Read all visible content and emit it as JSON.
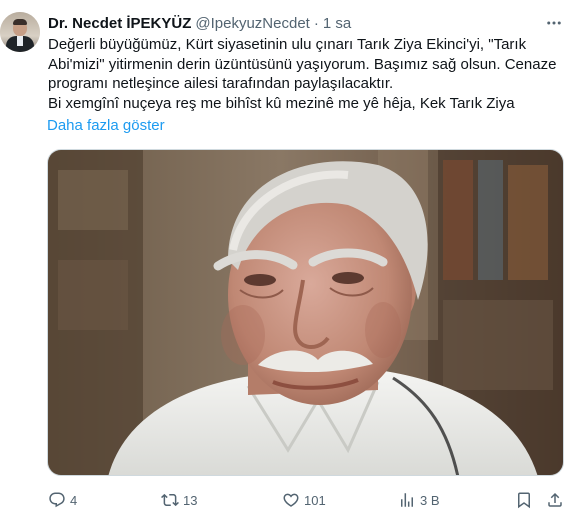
{
  "author": {
    "name": "Dr. Necdet İPEKYÜZ",
    "handle": "@IpekyuzNecdet",
    "separator": "·",
    "time": "1 sa"
  },
  "tweet": {
    "line1": "Değerli büyüğümüz, Kürt siyasetinin ulu çınarı Tarık Ziya Ekinci'yi, \"Tarık Abi'mizi\" yitirmenin derin üzüntüsünü yaşıyorum. Başımız sağ olsun. Cenaze programı netleşince ailesi tarafından paylaşılacaktır.",
    "line2": "Bi xemgînî nuçeya reş me bihîst kû mezinê me yê hêja, Kek Tarık Ziya",
    "show_more": "Daha fazla göster"
  },
  "actions": {
    "replies": "4",
    "reposts": "13",
    "likes": "101",
    "views": "3 B"
  },
  "icons": {
    "more": "more-horizontal-icon",
    "reply": "reply-icon",
    "repost": "repost-icon",
    "like": "heart-icon",
    "views": "views-icon",
    "bookmark": "bookmark-icon",
    "share": "share-icon"
  },
  "colors": {
    "text": "#0f1419",
    "secondary": "#536471",
    "link": "#1d9bf0",
    "border": "#cfd9de"
  }
}
